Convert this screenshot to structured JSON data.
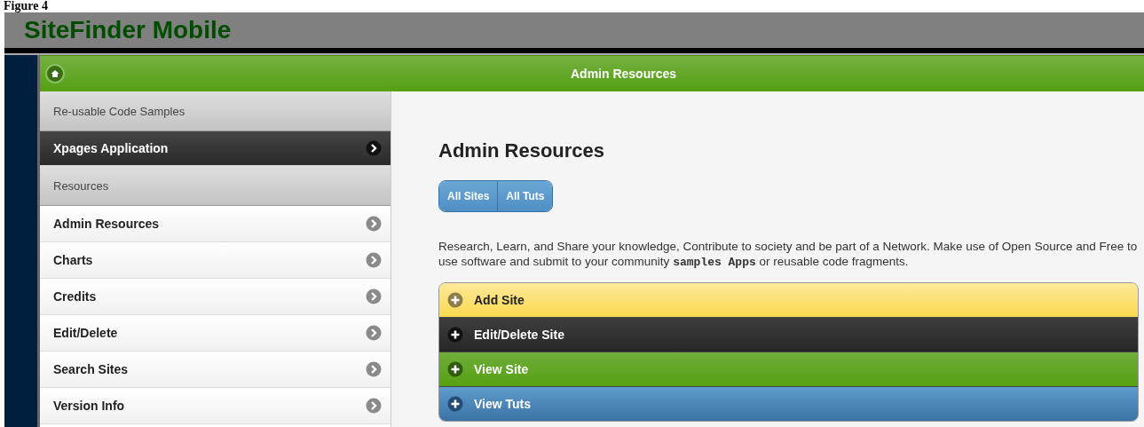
{
  "caption": "Figure 4",
  "app_title": "SiteFinder Mobile",
  "header": {
    "title": "Admin Resources"
  },
  "sidebar": {
    "items": [
      {
        "kind": "divider",
        "label": "Re-usable Code Samples"
      },
      {
        "kind": "link",
        "label": "Xpages Application",
        "selected": true
      },
      {
        "kind": "divider",
        "label": "Resources"
      },
      {
        "kind": "link",
        "label": "Admin Resources",
        "selected": false
      },
      {
        "kind": "link",
        "label": "Charts",
        "selected": false
      },
      {
        "kind": "link",
        "label": "Credits",
        "selected": false
      },
      {
        "kind": "link",
        "label": "Edit/Delete",
        "selected": false
      },
      {
        "kind": "link",
        "label": "Search Sites",
        "selected": false
      },
      {
        "kind": "link",
        "label": "Version Info",
        "selected": false
      }
    ]
  },
  "content": {
    "heading": "Admin Resources",
    "buttons": [
      "All Sites",
      "All Tuts"
    ],
    "description": [
      {
        "kind": "text",
        "text": "Research, Learn, and Share your knowledge, Contribute to society and be part of a Network. Make use of Open Source and Free to use software and submit to your community "
      },
      {
        "kind": "code",
        "text": "samples Apps"
      },
      {
        "kind": "text",
        "text": " or reusable code fragments."
      }
    ],
    "collapsibles": [
      {
        "label": "Add Site",
        "kind": "yellow"
      },
      {
        "label": "Edit/Delete Site",
        "kind": "dark"
      },
      {
        "label": "View Site",
        "kind": "green"
      },
      {
        "label": "View Tuts",
        "kind": "blue"
      }
    ]
  }
}
